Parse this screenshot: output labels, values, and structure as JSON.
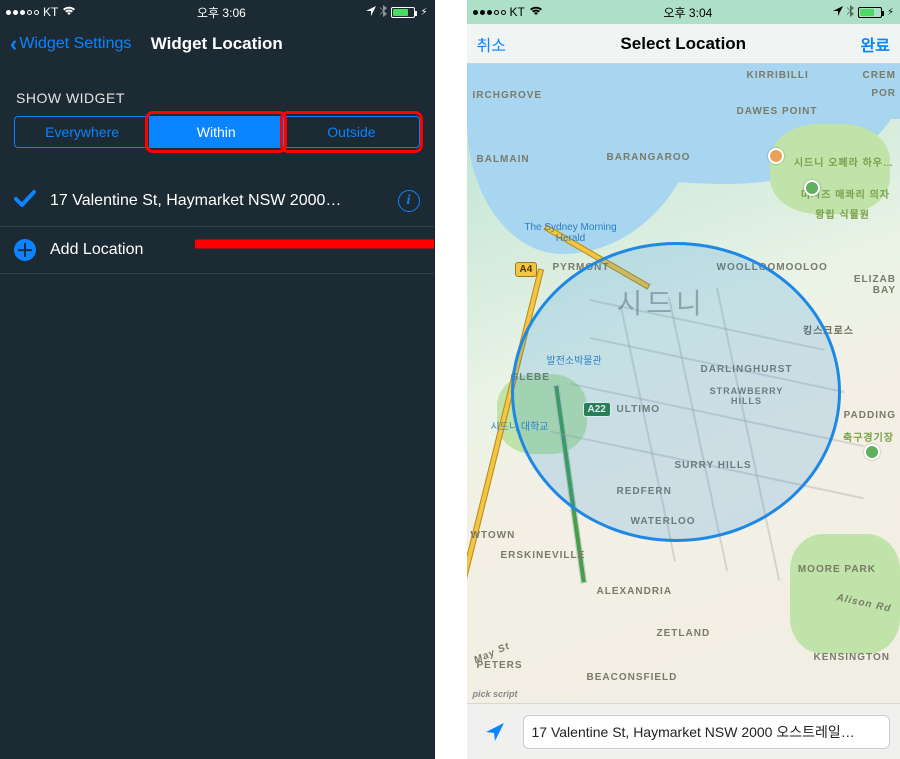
{
  "left": {
    "status": {
      "carrier": "KT",
      "time": "오후 3:06"
    },
    "nav": {
      "back": "Widget Settings",
      "title": "Widget Location"
    },
    "section_label": "SHOW WIDGET",
    "segments": [
      "Everywhere",
      "Within",
      "Outside"
    ],
    "active_segment": 1,
    "highlighted_segments": [
      1,
      2
    ],
    "rows": {
      "address": "17 Valentine St, Haymarket NSW 2000…",
      "add": "Add Location"
    }
  },
  "right": {
    "status": {
      "carrier": "KT",
      "time": "오후 3:04"
    },
    "nav": {
      "cancel": "취소",
      "title": "Select Location",
      "done": "완료"
    },
    "map": {
      "big_label": "시드니",
      "labels": {
        "kirribilli": "KIRRIBILLI",
        "cremorne": "CREM",
        "porp": "POR",
        "archgrove": "IRCHGROVE",
        "dawes": "DAWES POINT",
        "balmain": "BALMAIN",
        "barangaroo": "BARANGAROO",
        "opera_k": "시드니 오페라 하우…",
        "macquarie_k": "미시즈 매콰리 의자",
        "botanic_k": "왕립 식물원",
        "herald": "The Sydney Morning Herald",
        "pyrmont": "PYRMONT",
        "wool": "WOOLLOOMOOLOO",
        "eliz": "ELIZAB BAY",
        "kings_k": "킹스크로스",
        "museum_k": "발전소박물관",
        "glebe": "GLEBE",
        "darlinghurst": "DARLINGHURST",
        "strawberry": "STRAWBERRY HILLS",
        "ultimo": "ULTIMO",
        "paddington": "PADDING",
        "uni_k": "시드니 대학교",
        "soccer_k": "축구경기장",
        "surry": "SURRY HILLS",
        "redfern": "REDFERN",
        "waterloo": "WATERLOO",
        "wtown": "WTOWN",
        "erskineville": "ERSKINEVILLE",
        "moore": "MOORE PARK",
        "alexandria": "ALEXANDRIA",
        "alison": "Alison Rd",
        "zetland": "ZETLAND",
        "peters": "PETERS",
        "beaconsfield": "BEACONSFIELD",
        "kensington": "KENSINGTON",
        "may": "May St",
        "pick": "pick script",
        "a4": "A4",
        "a22": "A22"
      },
      "search_value": "17 Valentine St, Haymarket NSW 2000 오스트레일…"
    }
  }
}
